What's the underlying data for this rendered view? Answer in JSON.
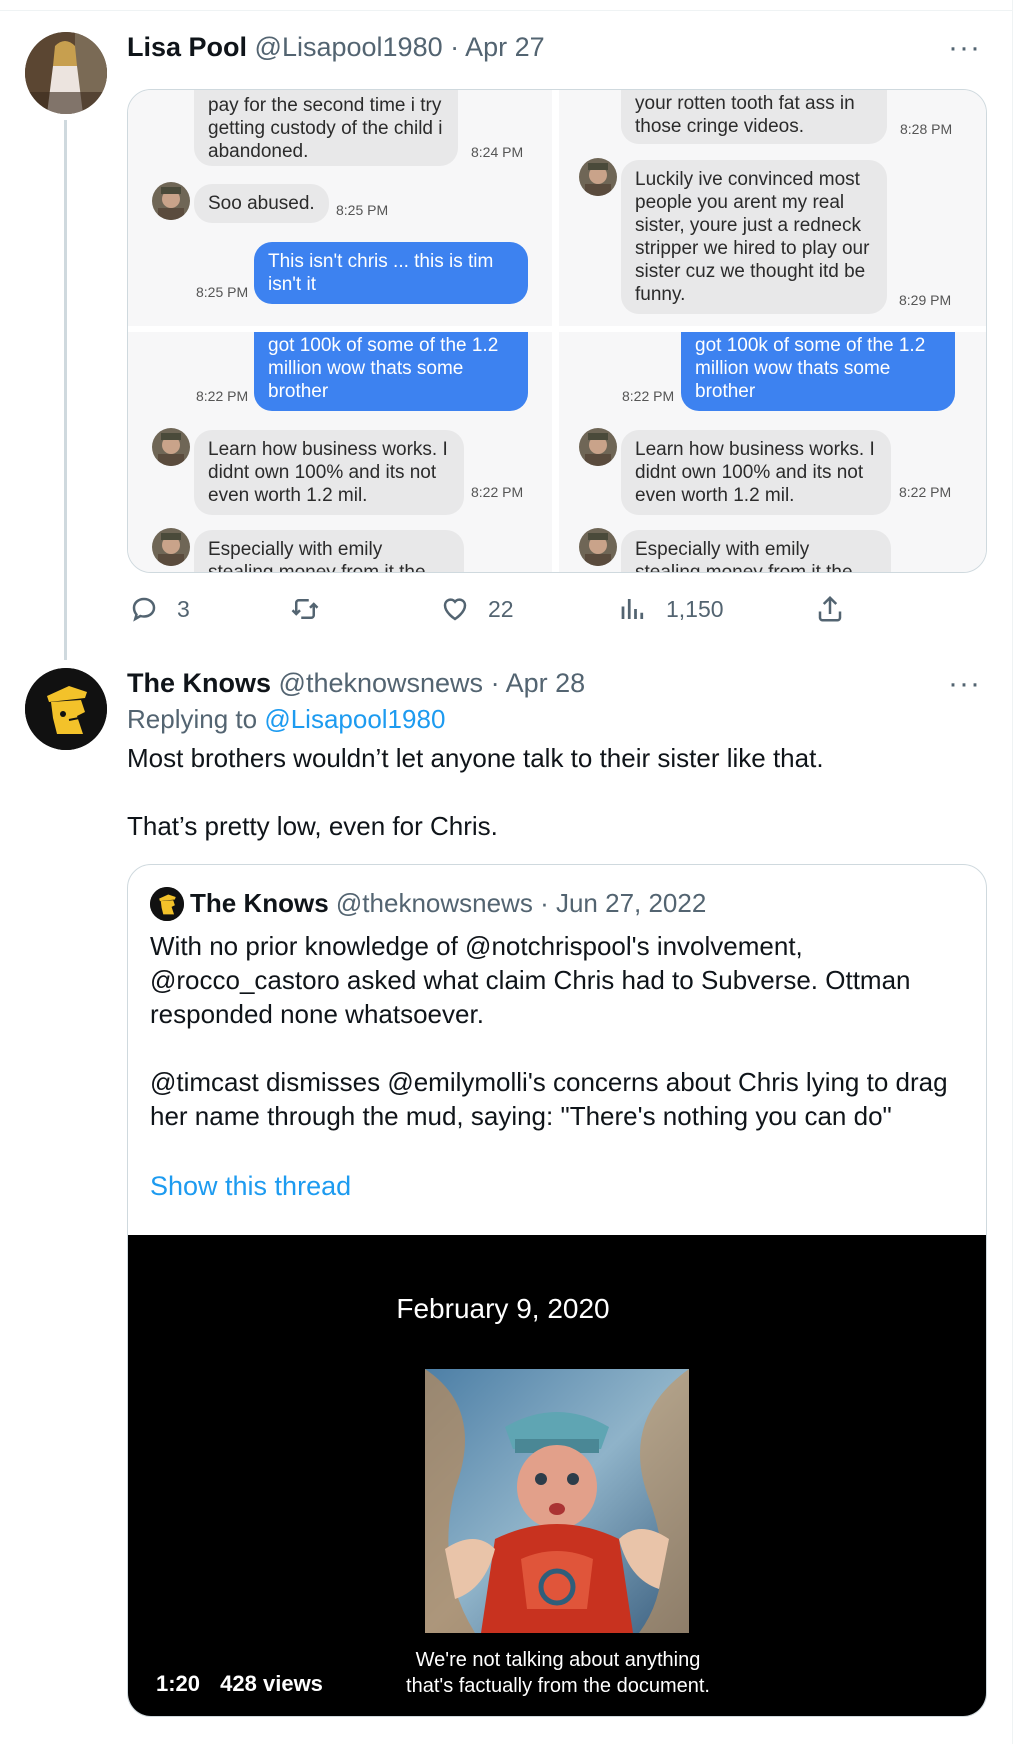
{
  "tweet1": {
    "name": "Lisa Pool",
    "handle": "@Lisapool1980",
    "date": "· Apr 27",
    "more": "···",
    "actions": {
      "replies": "3",
      "likes": "22",
      "views": "1,150"
    },
    "collage": {
      "tl": {
        "b1": "pay for the second time i try getting custody of the child i abandoned.",
        "t1": "8:24 PM",
        "b2": "Soo abused.",
        "t2": "8:25 PM",
        "b3": "This isn't chris ... this is tim isn't it",
        "t3": "8:25 PM"
      },
      "tr": {
        "b1": "your rotten tooth fat ass in those cringe videos.",
        "t1": "8:28 PM",
        "b2": "Luckily ive convinced most people you arent my real sister, youre just a redneck stripper we hired to play our sister cuz we thought itd be funny.",
        "t2": "8:29 PM"
      },
      "bl": {
        "b1": "got 100k of some of the 1.2 million wow thats some brother",
        "t1": "8:22 PM",
        "b2": "Learn how business works. I didnt own 100% and its not even worth 1.2 mil.",
        "t2": "8:22 PM",
        "b3": "Especially with emily stealing money from it the"
      },
      "br": {
        "b1": "got 100k of some of the 1.2 million wow thats some brother",
        "t1": "8:22 PM",
        "b2": "Learn how business works. I didnt own 100% and its not even worth 1.2 mil.",
        "t2": "8:22 PM",
        "b3": "Especially with emily stealing money from it the"
      }
    }
  },
  "tweet2": {
    "name": "The Knows",
    "handle": "@theknowsnews",
    "date": "· Apr 28",
    "more": "···",
    "replying_prefix": "Replying to ",
    "replying_handle": "@Lisapool1980",
    "line1": "Most brothers wouldn’t let anyone talk to their sister like that.",
    "line2": "That’s pretty low, even for Chris.",
    "quote": {
      "name": "The Knows",
      "handle": "@theknowsnews",
      "date": "· Jun 27, 2022",
      "para1": "With no prior knowledge of @notchrispool's involvement, @rocco_castoro asked what claim Chris had to Subverse. Ottman responded none whatsoever.",
      "para2": "@timcast dismisses @emilymolli's concerns about Chris lying to drag her name through the mud, saying: \"There's nothing you can do\"",
      "show_thread": "Show this thread",
      "video": {
        "date_text": "February 9, 2020",
        "caption_line1": "We're not talking about anything",
        "caption_line2": "that's factually from the document.",
        "duration": "1:20",
        "views": "428 views"
      }
    }
  },
  "colors": {
    "accent": "#1d9bf0",
    "secondary_text": "#536471",
    "imessage_blue": "#3d82f0",
    "border": "#cfd9de"
  }
}
